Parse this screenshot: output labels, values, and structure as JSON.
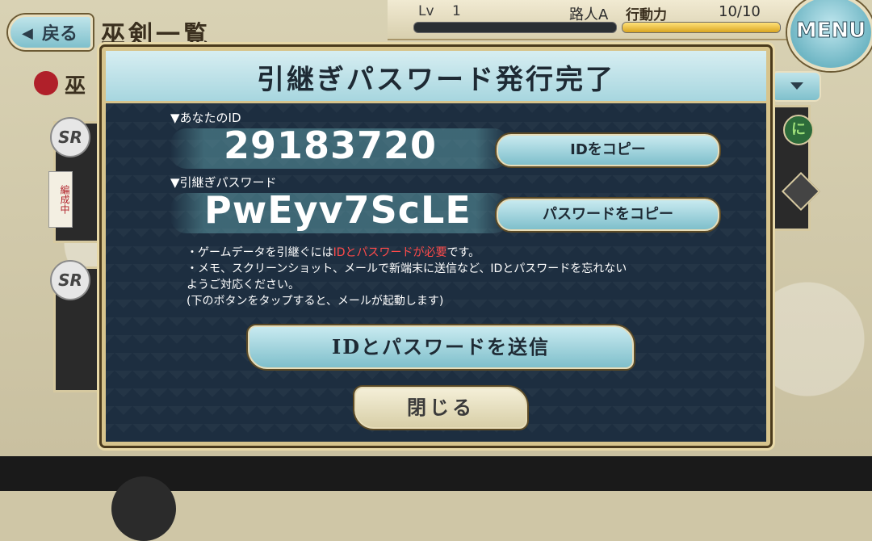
{
  "header": {
    "back_label": "戻る",
    "page_title": "巫剣一覧",
    "level_label": "Lv",
    "level_value": "1",
    "player_name": "路人A",
    "stamina_label": "行動力",
    "stamina_value": "10/10",
    "stamina_fill": 1.0,
    "menu_label": "MENU"
  },
  "background": {
    "side_label": "巫",
    "sr_badge_1": "SR",
    "sr_badge_2": "SR",
    "ribbon_tag": "編成中",
    "green_badge": "に"
  },
  "dialog": {
    "title": "引継ぎパスワード発行完了",
    "id_label": "▼あなたのID",
    "id_value": "29183720",
    "copy_id_label": "IDをコピー",
    "password_label": "▼引継ぎパスワード",
    "password_value": "PwEyv7ScLE",
    "copy_password_label": "パスワードをコピー",
    "note_line1_prefix": "・ゲームデータを引継ぐには",
    "note_line1_red": "IDとパスワードが必要",
    "note_line1_suffix": "です。",
    "note_line2": "・メモ、スクリーンショット、メールで新端末に送信など、IDとパスワードを忘れない",
    "note_line3": "ようご対応ください。",
    "note_line4": "(下のボタンをタップすると、メールが起動します)",
    "send_label": "IDとパスワードを送信",
    "close_label": "閉じる"
  },
  "colors": {
    "dialog_bg": "#1d2e40",
    "accent_button": "#7fbfcb",
    "gold_border": "#d7c48c",
    "warning_red": "#ff4a4a"
  }
}
